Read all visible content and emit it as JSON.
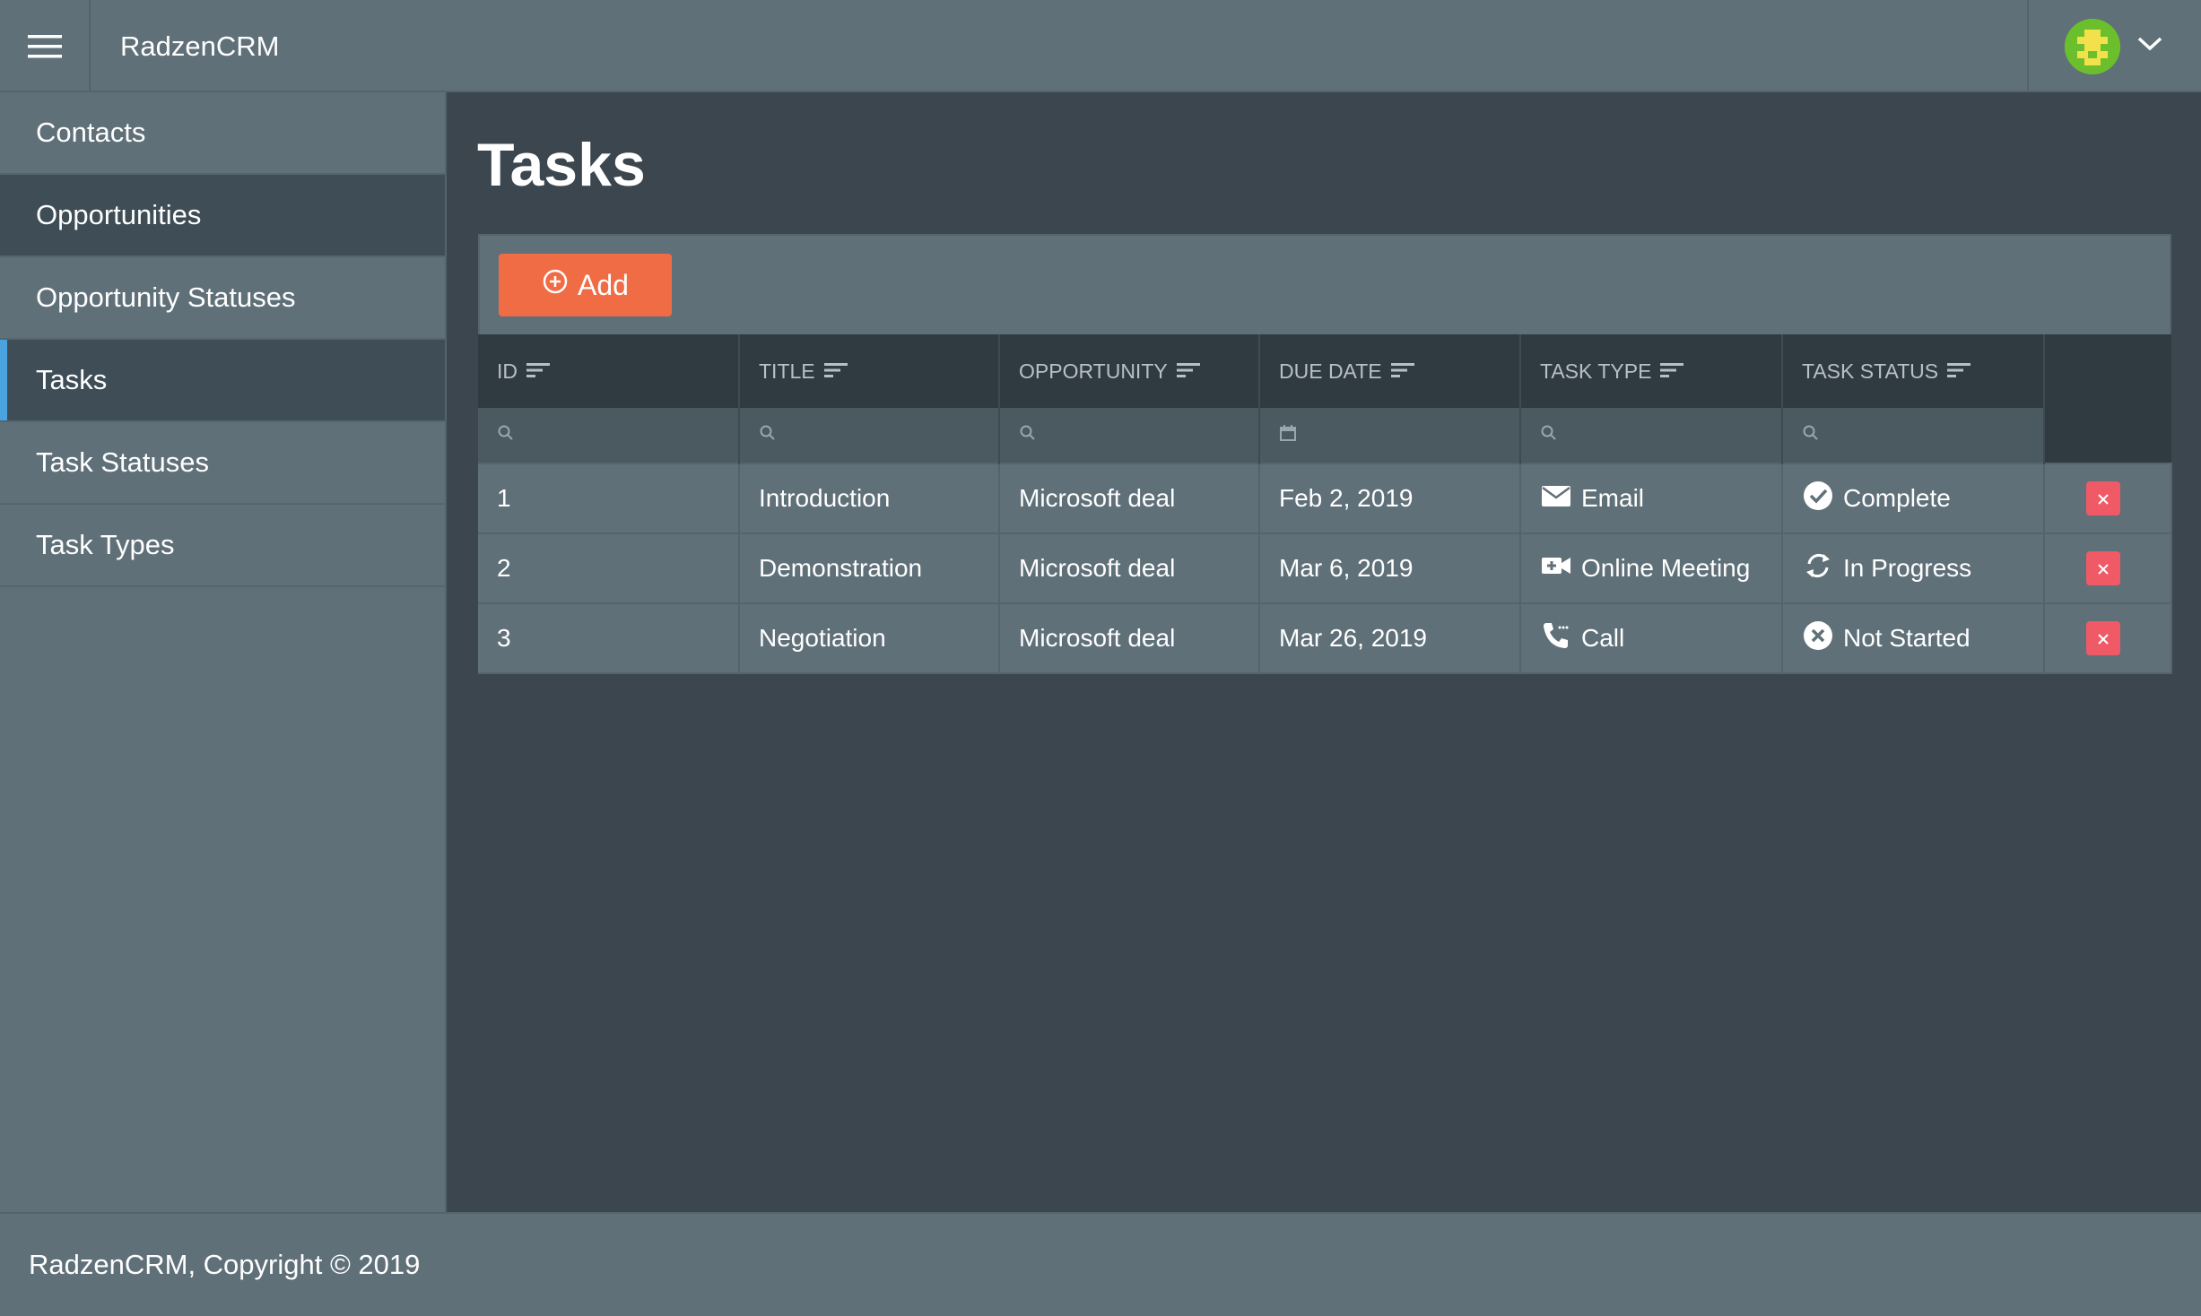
{
  "header": {
    "app_title": "RadzenCRM",
    "menu_icon": "hamburger-menu-icon",
    "avatar_icon": "user-avatar-icon",
    "dropdown_icon": "chevron-down-icon"
  },
  "sidebar": {
    "items": [
      {
        "label": "Contacts"
      },
      {
        "label": "Opportunities"
      },
      {
        "label": "Opportunity Statuses"
      },
      {
        "label": "Tasks"
      },
      {
        "label": "Task Statuses"
      },
      {
        "label": "Task Types"
      }
    ]
  },
  "main": {
    "page_title": "Tasks",
    "add_label": "Add"
  },
  "table": {
    "columns": [
      "ID",
      "TITLE",
      "OPPORTUNITY",
      "DUE DATE",
      "TASK TYPE",
      "TASK STATUS"
    ],
    "rows": [
      {
        "id": "1",
        "title": "Introduction",
        "opportunity": "Microsoft deal",
        "due_date": "Feb 2, 2019",
        "task_type": "Email",
        "task_type_icon": "email-icon",
        "task_status": "Complete",
        "task_status_icon": "check-circle-icon"
      },
      {
        "id": "2",
        "title": "Demonstration",
        "opportunity": "Microsoft deal",
        "due_date": "Mar 6, 2019",
        "task_type": "Online Meeting",
        "task_type_icon": "video-camera-icon",
        "task_status": "In Progress",
        "task_status_icon": "sync-icon"
      },
      {
        "id": "3",
        "title": "Negotiation",
        "opportunity": "Microsoft deal",
        "due_date": "Mar 26, 2019",
        "task_type": "Call",
        "task_type_icon": "phone-icon",
        "task_status": "Not Started",
        "task_status_icon": "x-circle-icon"
      }
    ]
  },
  "footer": {
    "text": "RadzenCRM, Copyright © 2019"
  },
  "colors": {
    "accent_add": "#f06c45",
    "delete": "#ef5a66",
    "active_indicator": "#4aa3df",
    "panel": "#607079",
    "background": "#3b464e"
  }
}
